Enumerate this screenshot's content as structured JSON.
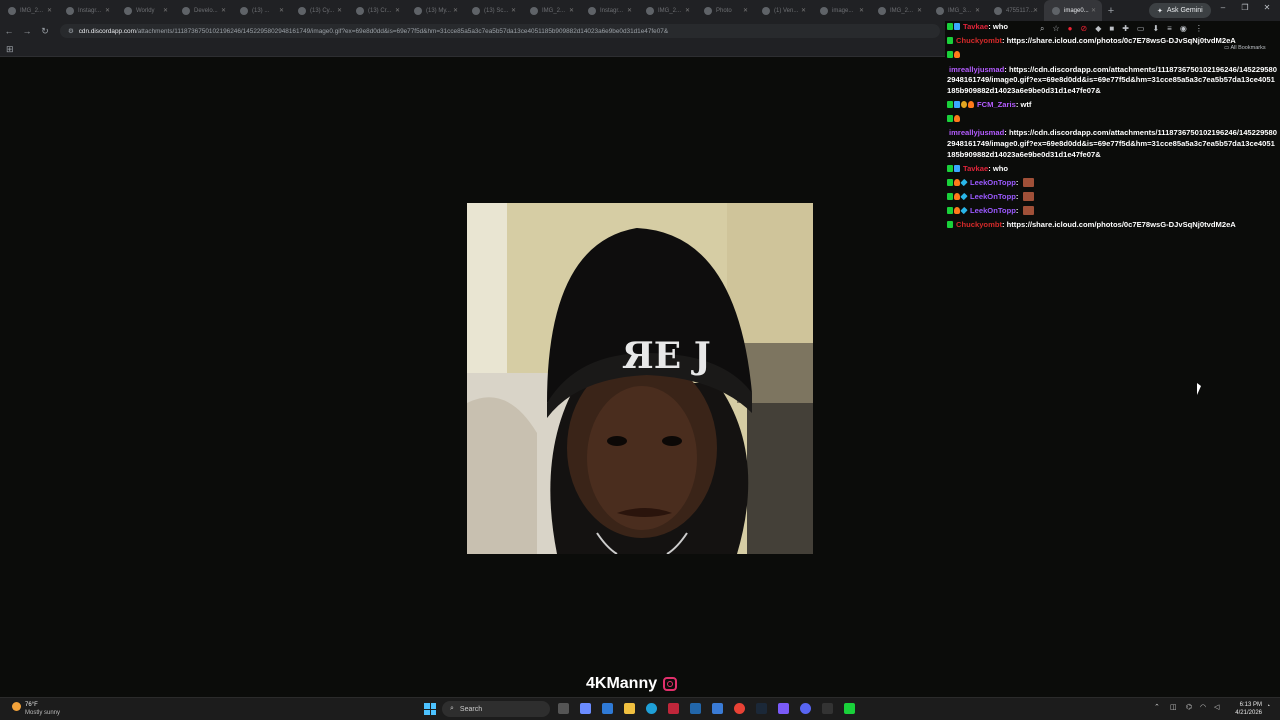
{
  "browser": {
    "tabs": [
      {
        "label": "IMG_2...",
        "active": false
      },
      {
        "label": "Instagr...",
        "active": false
      },
      {
        "label": "Worldy",
        "active": false
      },
      {
        "label": "Develo...",
        "active": false
      },
      {
        "label": "(13) ...",
        "active": false
      },
      {
        "label": "(13) Cy...",
        "active": false
      },
      {
        "label": "(13) Cr...",
        "active": false
      },
      {
        "label": "(13) My...",
        "active": false
      },
      {
        "label": "(13) Sc...",
        "active": false
      },
      {
        "label": "IMG_2...",
        "active": false
      },
      {
        "label": "Instagr...",
        "active": false
      },
      {
        "label": "IMG_2...",
        "active": false
      },
      {
        "label": "Photo",
        "active": false
      },
      {
        "label": "(1) Ven...",
        "active": false
      },
      {
        "label": "image...",
        "active": false
      },
      {
        "label": "IMG_2...",
        "active": false
      },
      {
        "label": "IMG_3...",
        "active": false
      },
      {
        "label": "4755117...",
        "active": false
      },
      {
        "label": "image0...",
        "active": true
      }
    ],
    "ask_gemini": "Ask Gemini",
    "url_host": "cdn.discordapp.com",
    "url_rest": "/attachments/1118736750102196246/1452295802948161749/image0.gif?ex=69e8d0dd&is=69e77f5d&hm=31cce85a5a3c7ea5b57da13ce4051185b909882d14023a6e9be0d31d1e47fe07&",
    "all_bookmarks": "All Bookmarks"
  },
  "chat": {
    "messages": [
      {
        "badges": [
          "k",
          "blue"
        ],
        "user": "Tavkae",
        "color": "#e0243a",
        "text": "who"
      },
      {
        "badges": [
          "k"
        ],
        "user": "Chuckyombt",
        "color": "#d42a2a",
        "text": "https://share.icloud.com/photos/0c7E78wsG-DJvSqNj0tvdM2eA"
      },
      {
        "badges": [
          "k",
          "fire"
        ],
        "user": "",
        "color": "#ffffff",
        "text": ""
      },
      {
        "badges": [],
        "user": "imreallyjusmad",
        "color": "#b45cff",
        "text": "https://cdn.discordapp.com/attachments/1118736750102196246/1452295802948161749/image0.gif?ex=69e8d0dd&is=69e77f5d&hm=31cce85a5a3c7ea5b57da13ce4051185b909882d14023a6e9be0d31d1e47fe07&"
      },
      {
        "badges": [
          "k",
          "blue",
          "gold",
          "fire"
        ],
        "user": "FCM_Zaris",
        "color": "#b45cff",
        "text": "wtf"
      },
      {
        "badges": [
          "k",
          "fire"
        ],
        "user": "",
        "color": "#ffffff",
        "text": ""
      },
      {
        "badges": [],
        "user": "imreallyjusmad",
        "color": "#b45cff",
        "text": "https://cdn.discordapp.com/attachments/1118736750102196246/1452295802948161749/image0.gif?ex=69e8d0dd&is=69e77f5d&hm=31cce85a5a3c7ea5b57da13ce4051185b909882d14023a6e9be0d31d1e47fe07&"
      },
      {
        "badges": [
          "k",
          "blue"
        ],
        "user": "Tavkae",
        "color": "#e0243a",
        "text": "who"
      },
      {
        "badges": [
          "k",
          "fire",
          "gem"
        ],
        "user": "LeekOnTopp",
        "color": "#9b59ff",
        "text": "",
        "emote": true
      },
      {
        "badges": [
          "k",
          "fire",
          "gem"
        ],
        "user": "LeekOnTopp",
        "color": "#9b59ff",
        "text": "",
        "emote": true
      },
      {
        "badges": [
          "k",
          "fire",
          "gem"
        ],
        "user": "LeekOnTopp",
        "color": "#9b59ff",
        "text": "",
        "emote": true
      },
      {
        "badges": [
          "k"
        ],
        "user": "Chuckyombt",
        "color": "#d42a2a",
        "text": "https://share.icloud.com/photos/0c7E78wsG-DJvSqNj0tvdM2eA"
      }
    ]
  },
  "stream": {
    "streamer_name": "4KManny"
  },
  "taskbar": {
    "weather_temp": "76°F",
    "weather_desc": "Mostly sunny",
    "search_placeholder": "Search",
    "time": "6:13 PM",
    "date": "4/21/2026"
  },
  "colors": {
    "accent_kick": "#19d13a",
    "instagram": "#e1306c",
    "background": "#0b0c0a"
  }
}
